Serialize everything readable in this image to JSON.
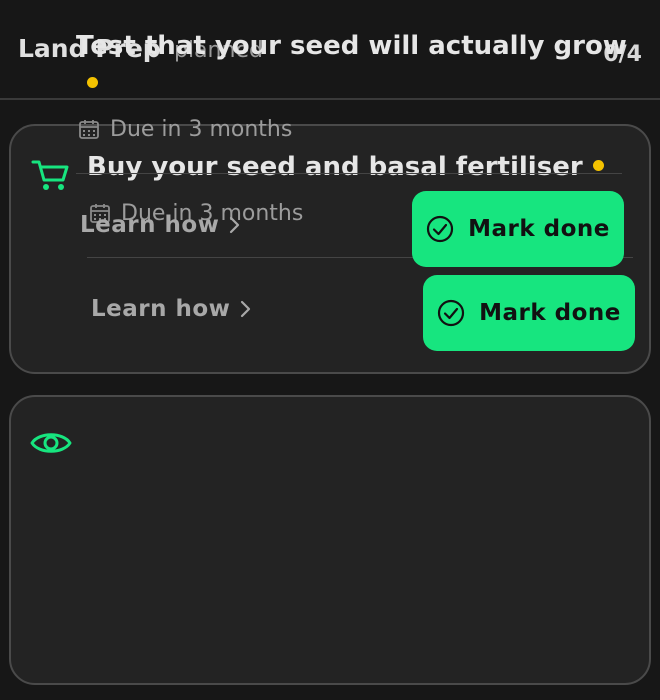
{
  "header": {
    "title": "Land Prep",
    "status": "planned",
    "count": "0/4"
  },
  "tasks": [
    {
      "icon": "shopping-cart-icon",
      "title": "Buy your seed and basal fertiliser",
      "due": "Due in 3 months",
      "learn_label": "Learn how",
      "done_label": "Mark done"
    },
    {
      "icon": "eye-icon",
      "title": "Test that your seed will actually grow",
      "due": "Due in 3 months",
      "learn_label": "Learn how",
      "done_label": "Mark done"
    }
  ],
  "colors": {
    "accent": "#17e57f",
    "dot": "#f4c200",
    "background": "#171717",
    "card": "#232323"
  }
}
